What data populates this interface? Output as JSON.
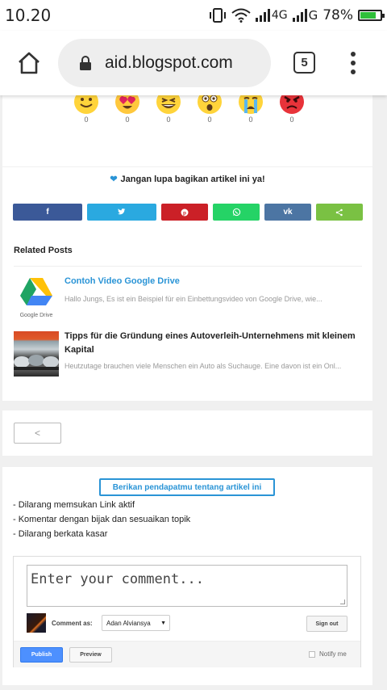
{
  "status_bar": {
    "time": "10.20",
    "network_1": "4G",
    "network_2": "G",
    "battery_percent": "78%",
    "battery_level": 0.78
  },
  "browser": {
    "url": "aid.blogspot.com",
    "tab_count": "5"
  },
  "reactions": [
    {
      "icon": "smile-emoji-icon",
      "count": "0"
    },
    {
      "icon": "heart-eyes-emoji-icon",
      "count": "0"
    },
    {
      "icon": "laughing-emoji-icon",
      "count": "0"
    },
    {
      "icon": "surprised-emoji-icon",
      "count": "0"
    },
    {
      "icon": "crying-emoji-icon",
      "count": "0"
    },
    {
      "icon": "angry-emoji-icon",
      "count": "0"
    }
  ],
  "share": {
    "note": "Jangan lupa bagikan artikel ini ya!",
    "buttons": [
      {
        "name": "facebook",
        "glyph": "f",
        "color": "#3b5998"
      },
      {
        "name": "twitter",
        "glyph": "🐦",
        "color": "#2aa9e0"
      },
      {
        "name": "pinterest",
        "glyph": "P",
        "color": "#cb2027"
      },
      {
        "name": "whatsapp",
        "glyph": "✆",
        "color": "#25d366"
      },
      {
        "name": "vk",
        "glyph": "vk",
        "color": "#4c75a3"
      },
      {
        "name": "share",
        "glyph": "<",
        "color": "#7ac143"
      }
    ]
  },
  "related": {
    "title": "Related Posts",
    "posts": [
      {
        "title": "Contoh Video Google Drive",
        "excerpt": "Hallo Jungs, Es ist ein Beispiel für ein Einbettungsvideo von Google Drive, wie...",
        "thumb_caption": "Google Drive"
      },
      {
        "title": "Tipps für die Gründung eines Autoverleih-Unternehmens mit kleinem Kapital",
        "excerpt": "Heutzutage brauchen viele Menschen ein Auto als Suchauge. Eine davon ist ein Onl..."
      }
    ]
  },
  "pager": {
    "prev_glyph": "<"
  },
  "comments": {
    "heading": "Berikan pendapatmu tentang artikel ini",
    "rules": [
      "- Dilarang memsukan Link aktif",
      "- Komentar dengan bijak dan sesuaikan topik",
      "- Dilarang berkata kasar"
    ],
    "placeholder": "Enter your comment...",
    "comment_as_label": "Comment as:",
    "comment_as_value": "Adan Alviansya",
    "sign_out": "Sign out",
    "publish": "Publish",
    "preview": "Preview",
    "notify": "Notify me"
  }
}
